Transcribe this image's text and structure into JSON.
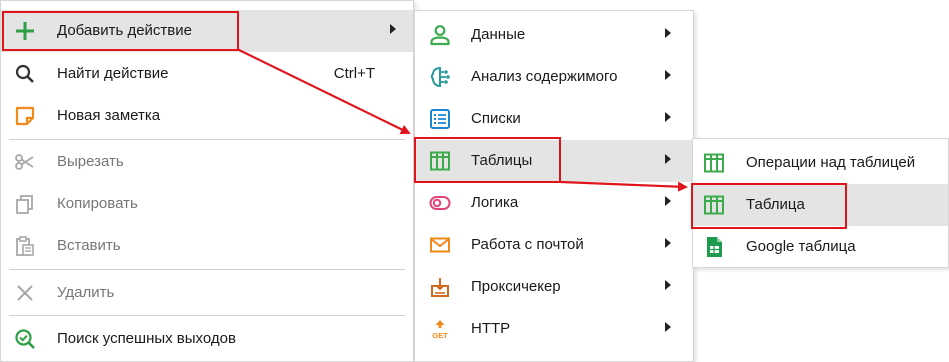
{
  "menu_main": {
    "items": [
      {
        "label": "Добавить действие",
        "icon": "plus-icon",
        "has_submenu": true,
        "state": "highlighted"
      },
      {
        "label": "Найти действие",
        "icon": "search-icon",
        "shortcut": "Ctrl+T"
      },
      {
        "label": "Новая заметка",
        "icon": "note-icon"
      },
      {
        "label": "Вырезать",
        "icon": "scissors-icon",
        "state": "disabled"
      },
      {
        "label": "Копировать",
        "icon": "copy-icon",
        "state": "disabled"
      },
      {
        "label": "Вставить",
        "icon": "paste-icon",
        "state": "disabled"
      },
      {
        "label": "Удалить",
        "icon": "close-icon",
        "state": "disabled"
      },
      {
        "label": "Поиск успешных выходов",
        "icon": "search-check-icon"
      }
    ]
  },
  "menu_actions": {
    "items": [
      {
        "label": "Данные",
        "icon": "user-icon",
        "has_submenu": true
      },
      {
        "label": "Анализ содержимого",
        "icon": "brain-icon",
        "has_submenu": true
      },
      {
        "label": "Списки",
        "icon": "list-icon",
        "has_submenu": true
      },
      {
        "label": "Таблицы",
        "icon": "table-icon",
        "has_submenu": true,
        "state": "highlighted"
      },
      {
        "label": "Логика",
        "icon": "logic-toggle-icon",
        "has_submenu": true
      },
      {
        "label": "Работа с почтой",
        "icon": "mail-icon",
        "has_submenu": true
      },
      {
        "label": "Проксичекер",
        "icon": "proxy-checker-icon",
        "has_submenu": true
      },
      {
        "label": "HTTP",
        "icon": "http-get-icon",
        "has_submenu": true
      }
    ]
  },
  "menu_tables": {
    "items": [
      {
        "label": "Операции над таблицей",
        "icon": "table-icon"
      },
      {
        "label": "Таблица",
        "icon": "table-icon",
        "state": "highlighted"
      },
      {
        "label": "Google таблица",
        "icon": "google-sheets-icon"
      }
    ]
  },
  "colors": {
    "highlight_border": "#e0151b",
    "hover_background": "#e4e4e4",
    "green_icon": "#3cab4d",
    "orange_icon": "#f08a1c",
    "blue_icon": "#1e86d6"
  }
}
